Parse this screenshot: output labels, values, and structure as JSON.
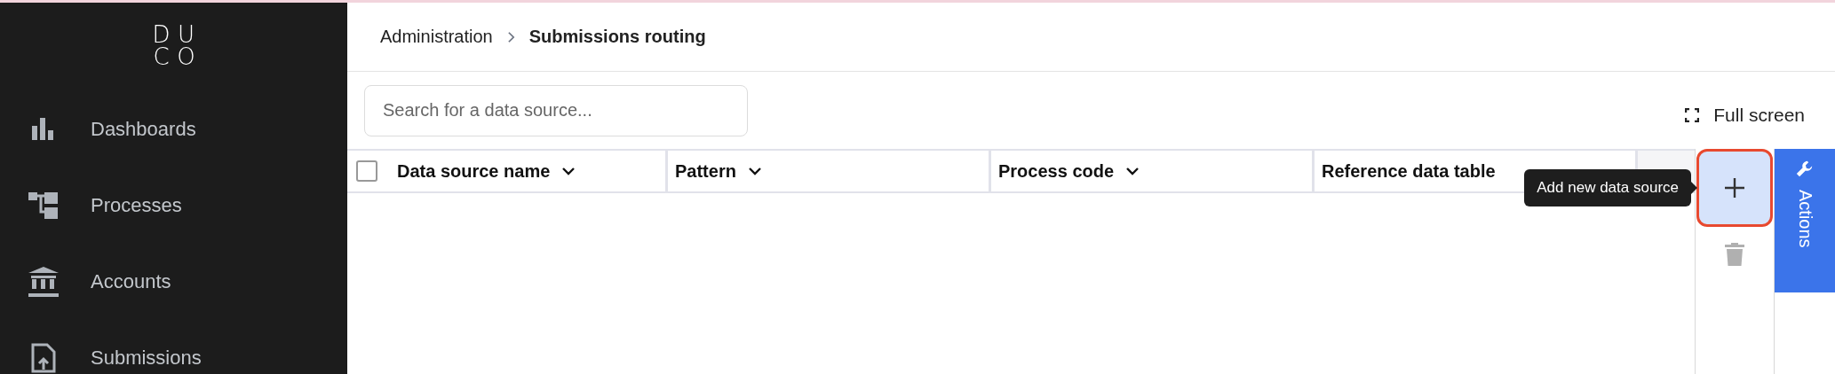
{
  "sidebar": {
    "logo": [
      "D",
      "U",
      "C",
      "O"
    ],
    "items": [
      {
        "label": "Dashboards",
        "kind": "chart"
      },
      {
        "label": "Processes",
        "kind": "tree"
      },
      {
        "label": "Accounts",
        "kind": "bank"
      },
      {
        "label": "Submissions",
        "kind": "upload"
      }
    ]
  },
  "breadcrumb": {
    "parent": "Administration",
    "current": "Submissions routing"
  },
  "search": {
    "placeholder": "Search for a data source..."
  },
  "full_screen": "Full screen",
  "table": {
    "select_all_checked": false,
    "columns": [
      {
        "label": "Data source name",
        "chevron": true
      },
      {
        "label": "Pattern",
        "chevron": true
      },
      {
        "label": "Process code",
        "chevron": true
      },
      {
        "label": "Reference data table",
        "chevron": false
      }
    ]
  },
  "actions": {
    "add": {
      "highlighted": true,
      "tooltip": "Add new data source"
    },
    "delete": {
      "disabled": true
    },
    "tab": "Actions"
  }
}
